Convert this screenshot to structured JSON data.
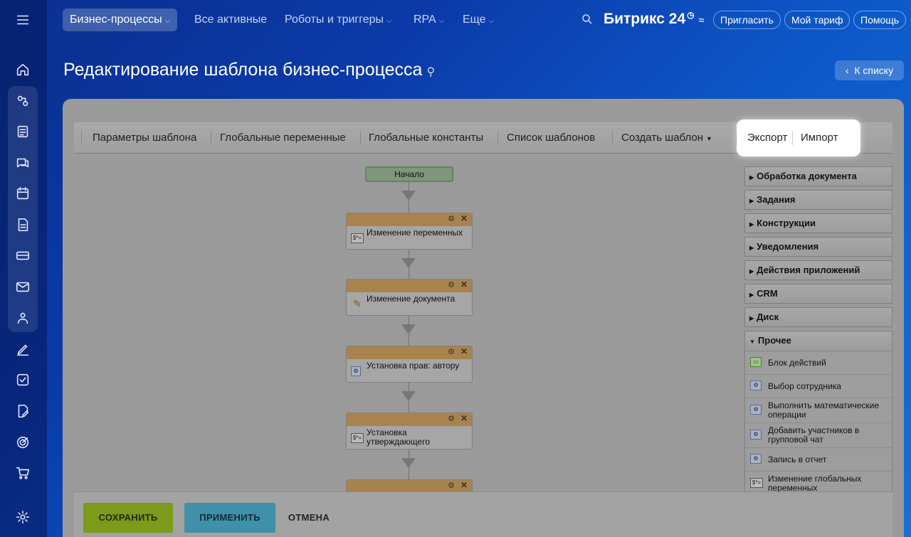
{
  "topnav": {
    "items": [
      {
        "label": "Бизнес-процессы",
        "active": true,
        "dropdown": true
      },
      {
        "label": "Все активные",
        "active": false,
        "dropdown": false
      },
      {
        "label": "Роботы и триггеры",
        "active": false,
        "dropdown": true
      },
      {
        "label": "RPA",
        "active": false,
        "dropdown": true
      },
      {
        "label": "Еще",
        "active": false,
        "dropdown": true
      }
    ],
    "logo": "Битрикс 24",
    "invite": "Пригласить",
    "tariff": "Мой тариф",
    "help": "Помощь"
  },
  "page": {
    "title": "Редактирование шаблона бизнес-процесса",
    "back_label": "К списку"
  },
  "toolbar": {
    "params": "Параметры шаблона",
    "globals": "Глобальные переменные",
    "constants": "Глобальные константы",
    "list": "Список шаблонов",
    "create": "Создать шаблон",
    "export": "Экспорт",
    "import": "Импорт"
  },
  "workflow": {
    "start": "Начало",
    "activities": [
      {
        "label": "Изменение переменных",
        "icon": "$*="
      },
      {
        "label": "Изменение документа",
        "icon": "pencil"
      },
      {
        "label": "Установка прав: автору",
        "icon": "gear"
      },
      {
        "label": "Установка утверждающего",
        "icon": "$*="
      }
    ]
  },
  "palette": {
    "categories": [
      "Обработка документа",
      "Задания",
      "Конструкции",
      "Уведомления",
      "Действия приложений",
      "CRM",
      "Диск"
    ],
    "open_category": "Прочее",
    "items": [
      "Блок действий",
      "Выбор сотрудника",
      "Выполнить математические операции",
      "Добавить участников в групповой чат",
      "Запись в отчет",
      "Изменение глобальных переменных"
    ]
  },
  "footer": {
    "save": "Сохранить",
    "apply": "Применить",
    "cancel": "Отмена"
  }
}
